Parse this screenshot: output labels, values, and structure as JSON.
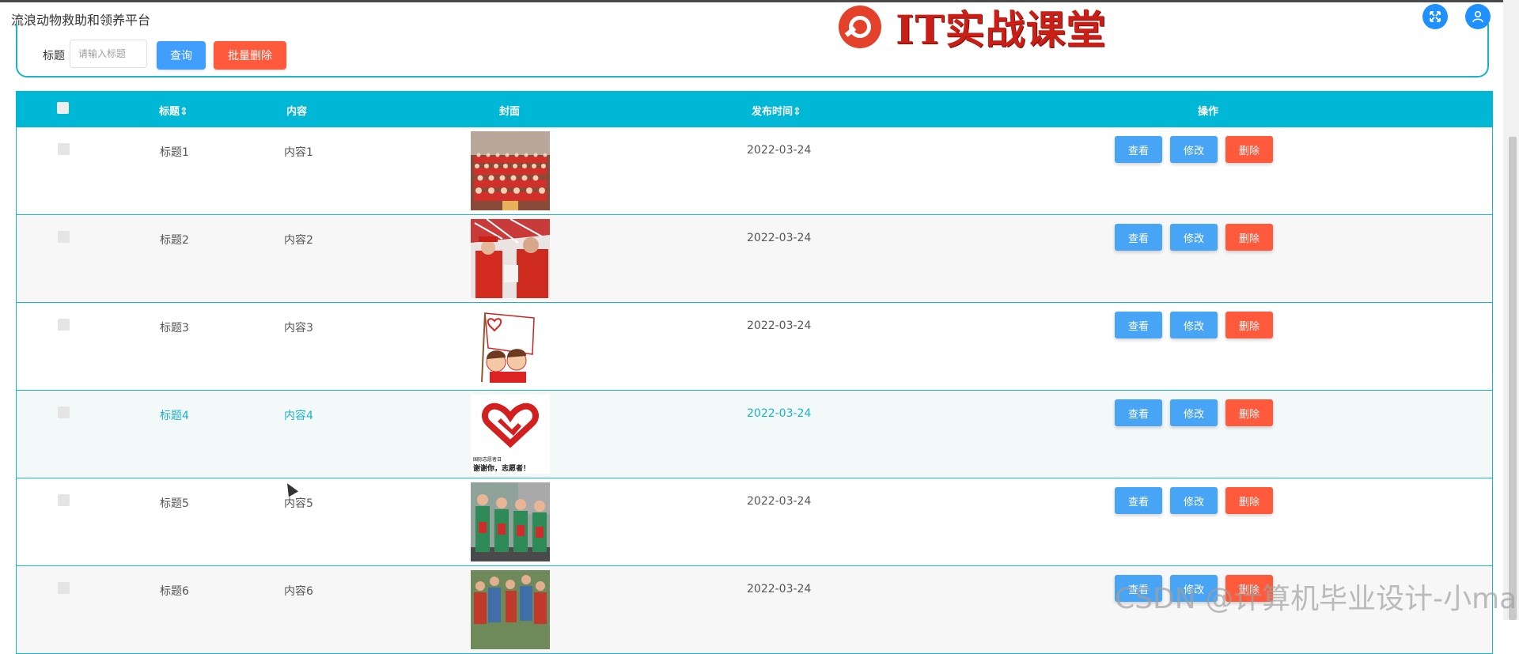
{
  "app": {
    "title": "流浪动物救助和领养平台"
  },
  "brand": {
    "text": "IT实战课堂",
    "logo_color": "#e4412a",
    "text_color": "#c91f16"
  },
  "header_icons": {
    "expand": "fullscreen-icon",
    "user": "user-icon",
    "color": "#1e90ff"
  },
  "search": {
    "label": "标题",
    "placeholder": "请输入标题",
    "value": "",
    "query_button": "查询",
    "batch_delete_button": "批量删除"
  },
  "table": {
    "headers": {
      "title": "标题",
      "content": "内容",
      "cover": "封面",
      "publish_time": "发布时间",
      "actions": "操作"
    },
    "header_color": "#00b8d6",
    "rows": [
      {
        "title": "标题1",
        "content": "内容1",
        "date": "2022-03-24",
        "cover": "volunteer-group-photo"
      },
      {
        "title": "标题2",
        "content": "内容2",
        "date": "2022-03-24",
        "cover": "volunteers-in-red"
      },
      {
        "title": "标题3",
        "content": "内容3",
        "date": "2022-03-24",
        "cover": "little-volunteer-flag"
      },
      {
        "title": "标题4",
        "content": "内容4",
        "date": "2022-03-24",
        "cover": "heart-hand-poster",
        "active": true
      },
      {
        "title": "标题5",
        "content": "内容5",
        "date": "2022-03-24",
        "cover": "volunteers-green-vests"
      },
      {
        "title": "标题6",
        "content": "内容6",
        "date": "2022-03-24",
        "cover": "crowd-photo"
      }
    ],
    "row_actions": {
      "view": "查看",
      "edit": "修改",
      "delete": "删除"
    },
    "poster_text": {
      "small": "国际志愿者日",
      "large": "谢谢你，志愿者！"
    }
  },
  "watermark": "CSDN @计算机毕业设计-小ma"
}
